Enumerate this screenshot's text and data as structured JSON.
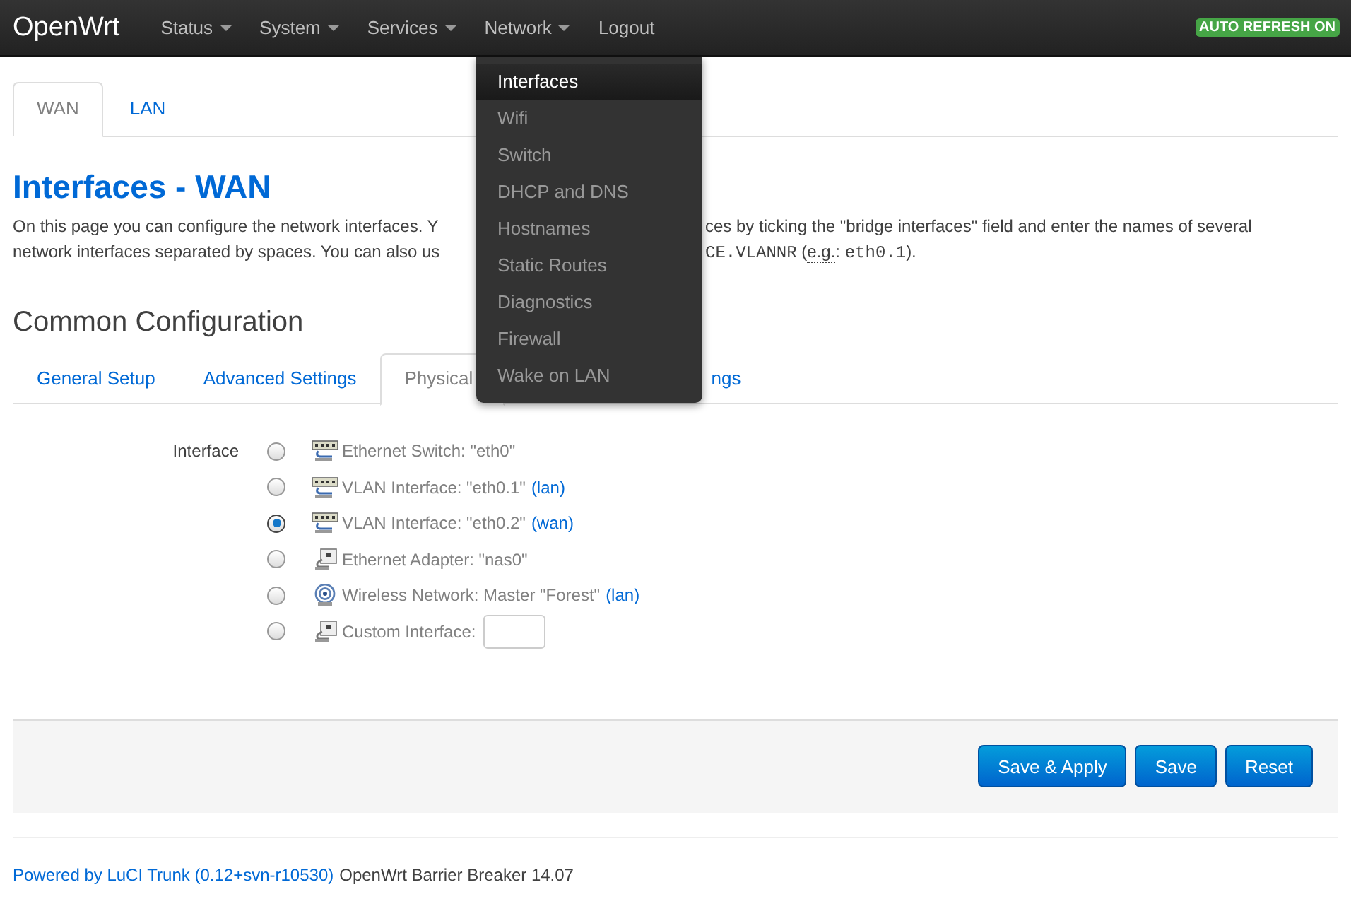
{
  "navbar": {
    "brand": "OpenWrt",
    "menus": [
      {
        "label": "Status",
        "kind": "dropdown"
      },
      {
        "label": "System",
        "kind": "dropdown"
      },
      {
        "label": "Services",
        "kind": "dropdown"
      },
      {
        "label": "Network",
        "kind": "dropdown"
      },
      {
        "label": "Logout",
        "kind": "link"
      }
    ],
    "badge": "AUTO REFRESH ON"
  },
  "dropdown": [
    {
      "label": "Interfaces",
      "selected": true
    },
    {
      "label": "Wifi",
      "selected": false
    },
    {
      "label": "Switch",
      "selected": false
    },
    {
      "label": "DHCP and DNS",
      "selected": false
    },
    {
      "label": "Hostnames",
      "selected": false
    },
    {
      "label": "Static Routes",
      "selected": false
    },
    {
      "label": "Diagnostics",
      "selected": false
    },
    {
      "label": "Firewall",
      "selected": false
    },
    {
      "label": "Wake on LAN",
      "selected": false
    }
  ],
  "tabs": [
    {
      "label": "WAN",
      "selected": true
    },
    {
      "label": "LAN",
      "selected": false
    }
  ],
  "title": "Interfaces - WAN",
  "description": [
    {
      "left": "On this page you can configure the network interfaces. Y",
      "right": [
        {
          "kind": "plain",
          "text": "ces by ticking the \"bridge interfaces\" field and enter the names of several"
        }
      ]
    },
    {
      "left": "network interfaces separated by spaces. You can also us",
      "right": [
        {
          "kind": "code",
          "text": "CE.VLANNR"
        },
        {
          "kind": "plain",
          "text": " ("
        },
        {
          "kind": "abbr",
          "text": "e.g."
        },
        {
          "kind": "plain",
          "text": ": "
        },
        {
          "kind": "code",
          "text": "eth0.1"
        },
        {
          "kind": "plain",
          "text": ")."
        }
      ]
    }
  ],
  "section_title": "Common Configuration",
  "subtabs": [
    {
      "label": "General Setup",
      "selected": false
    },
    {
      "label": "Advanced Settings",
      "selected": false
    },
    {
      "label": "Physical",
      "selected": true
    },
    {
      "label": "ngs",
      "selected": false
    }
  ],
  "form": {
    "label": "Interface",
    "options": [
      {
        "kind": "switch",
        "text": "Ethernet Switch: \"eth0\"",
        "selected": false
      },
      {
        "kind": "switch",
        "text": "VLAN Interface: \"eth0.1\"",
        "link": "(lan)",
        "selected": false
      },
      {
        "kind": "switch",
        "text": "VLAN Interface: \"eth0.2\"",
        "link": "(wan)",
        "selected": true
      },
      {
        "kind": "ethernet",
        "text": "Ethernet Adapter: \"nas0\"",
        "selected": false
      },
      {
        "kind": "wifi",
        "text": "Wireless Network: Master \"Forest\"",
        "link": "(lan)",
        "selected": false
      },
      {
        "kind": "custom",
        "text": "Custom Interface:",
        "selected": false
      }
    ]
  },
  "buttons": [
    "Save & Apply",
    "Save",
    "Reset"
  ],
  "footer": {
    "link": "Powered by LuCI Trunk (0.12+svn-r10530)",
    "text": "OpenWrt Barrier Breaker 14.07"
  }
}
